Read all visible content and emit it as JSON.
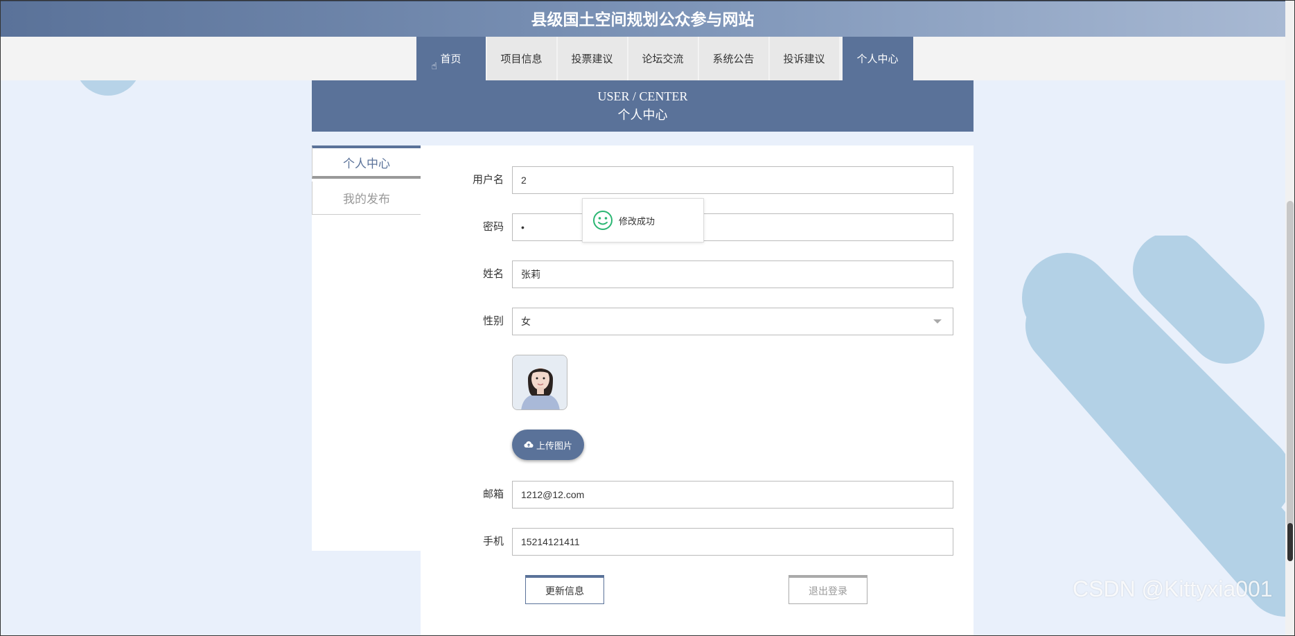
{
  "site": {
    "title": "县级国土空间规划公众参与网站"
  },
  "nav": {
    "items": [
      {
        "label": "首页"
      },
      {
        "label": "项目信息"
      },
      {
        "label": "投票建议"
      },
      {
        "label": "论坛交流"
      },
      {
        "label": "系统公告"
      },
      {
        "label": "投诉建议"
      },
      {
        "label": "个人中心"
      }
    ]
  },
  "banner": {
    "en": "USER / CENTER",
    "cn": "个人中心"
  },
  "sidebar": {
    "items": [
      {
        "label": "个人中心"
      },
      {
        "label": "我的发布"
      }
    ]
  },
  "form": {
    "username_label": "用户名",
    "username_value": "2",
    "password_label": "密码",
    "password_value": "•",
    "name_label": "姓名",
    "name_value": "张莉",
    "gender_label": "性别",
    "gender_value": "女",
    "upload_label": "上传图片",
    "email_label": "邮箱",
    "email_value": "1212@12.com",
    "phone_label": "手机",
    "phone_value": "15214121411",
    "update_label": "更新信息",
    "logout_label": "退出登录"
  },
  "toast": {
    "message": "修改成功"
  },
  "watermark": "CSDN @Kittyxia001",
  "colors": {
    "primary": "#5a7299",
    "background": "#e9f0fb",
    "accent": "#b3d1e6",
    "success": "#2bb673"
  }
}
